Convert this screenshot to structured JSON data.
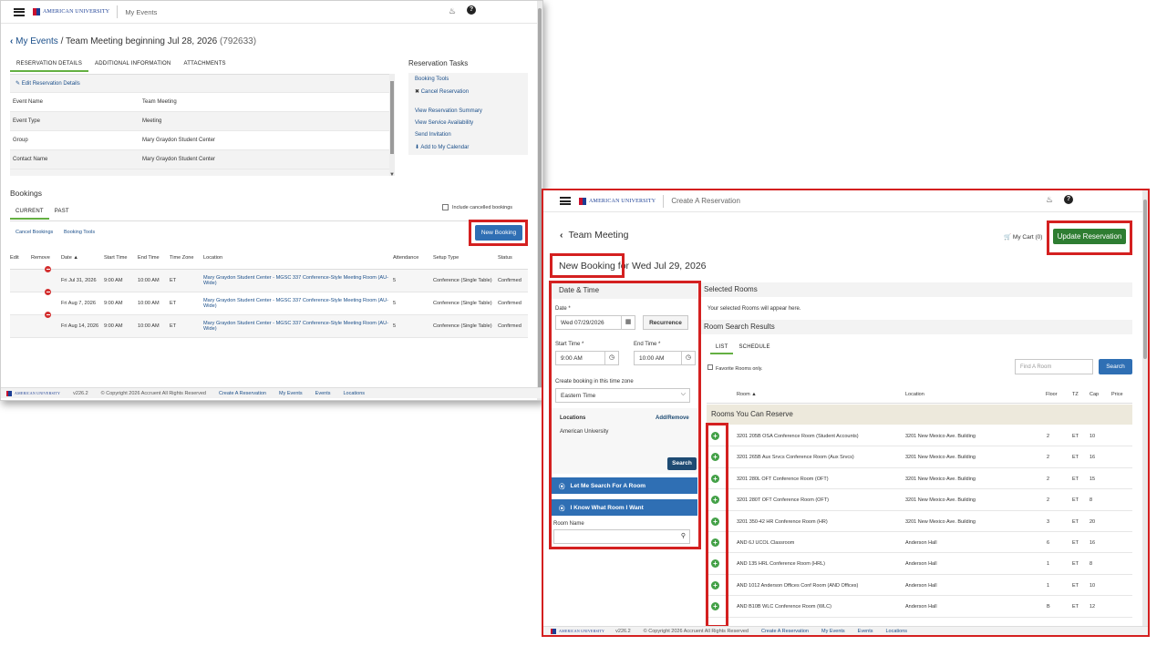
{
  "left": {
    "app_title": "My Events",
    "logo_text": "AMERICAN UNIVERSITY",
    "breadcrumb_root": "My Events",
    "breadcrumb_title": "Team Meeting beginning Jul 28, 2026",
    "breadcrumb_id": "(792633)",
    "tabs": [
      "RESERVATION DETAILS",
      "ADDITIONAL INFORMATION",
      "ATTACHMENTS"
    ],
    "edit_link": "Edit Reservation Details",
    "details": [
      {
        "label": "Event Name",
        "value": "Team Meeting"
      },
      {
        "label": "Event Type",
        "value": "Meeting"
      },
      {
        "label": "Group",
        "value": "Mary Graydon Student Center"
      },
      {
        "label": "Contact Name",
        "value": "Mary Graydon Student Center"
      }
    ],
    "tasks_title": "Reservation Tasks",
    "tasks": [
      "Booking Tools",
      "Cancel Reservation",
      "View Reservation Summary",
      "View Service Availability",
      "Send Invitation",
      "Add to My Calendar"
    ],
    "bookings_title": "Bookings",
    "booking_tabs": [
      "CURRENT",
      "PAST"
    ],
    "include_cancelled": "Include cancelled bookings",
    "cancel_bookings": "Cancel Bookings",
    "booking_tools": "Booking Tools",
    "new_booking": "New Booking",
    "columns": [
      "Edit",
      "Remove",
      "Date",
      "Start Time",
      "End Time",
      "Time Zone",
      "Location",
      "Attendance",
      "Setup Type",
      "Status"
    ],
    "rows": [
      {
        "date": "Fri Jul 31, 2026",
        "start": "9:00 AM",
        "end": "10:00 AM",
        "tz": "ET",
        "location": "Mary Graydon Student Center - MGSC 337 Conference-Style Meeting Room (AU-Wide)",
        "attendance": "5",
        "setup": "Conference (Single Table)",
        "status": "Confirmed"
      },
      {
        "date": "Fri Aug 7, 2026",
        "start": "9:00 AM",
        "end": "10:00 AM",
        "tz": "ET",
        "location": "Mary Graydon Student Center - MGSC 337 Conference-Style Meeting Room (AU-Wide)",
        "attendance": "5",
        "setup": "Conference (Single Table)",
        "status": "Confirmed"
      },
      {
        "date": "Fri Aug 14, 2026",
        "start": "9:00 AM",
        "end": "10:00 AM",
        "tz": "ET",
        "location": "Mary Graydon Student Center - MGSC 337 Conference-Style Meeting Room (AU-Wide)",
        "attendance": "5",
        "setup": "Conference (Single Table)",
        "status": "Confirmed"
      }
    ],
    "footer": {
      "version": "v226.2",
      "copyright": "© Copyright 2026 Accruent All Rights Reserved",
      "links": [
        "Create A Reservation",
        "My Events",
        "Events",
        "Locations"
      ]
    }
  },
  "right": {
    "app_title": "Create A Reservation",
    "logo_text": "AMERICAN UNIVERSITY",
    "back_title": "Team Meeting",
    "cart": "My Cart (0)",
    "update_btn": "Update Reservation",
    "heading_a": "New Booking",
    "heading_b": "for Wed Jul 29, 2026",
    "date_time": "Date & Time",
    "date_label": "Date *",
    "date_value": "Wed 07/29/2026",
    "recurrence": "Recurrence",
    "start_label": "Start Time *",
    "start_value": "9:00 AM",
    "end_label": "End Time *",
    "end_value": "10:00 AM",
    "tz_label": "Create booking in this time zone",
    "tz_value": "Eastern Time",
    "locations_label": "Locations",
    "add_remove": "Add/Remove",
    "location_value": "American University",
    "search_btn": "Search",
    "let_me_search": "Let Me Search For A Room",
    "i_know": "I Know What Room I Want",
    "room_name_label": "Room Name",
    "selected_rooms": "Selected Rooms",
    "selected_hint": "Your selected Rooms will appear here.",
    "room_search_results": "Room Search Results",
    "result_tabs": [
      "LIST",
      "SCHEDULE"
    ],
    "favorite": "Favorite Rooms only.",
    "find_placeholder": "Find A Room",
    "search2": "Search",
    "columns": [
      "Room",
      "Location",
      "Floor",
      "TZ",
      "Cap",
      "Price"
    ],
    "group_header": "Rooms You Can Reserve",
    "rooms": [
      {
        "room": "3201 205B OSA Conference Room (Student Accounts)",
        "location": "3201 New Mexico Ave. Building",
        "floor": "2",
        "tz": "ET",
        "cap": "10"
      },
      {
        "room": "3201 265B Aux Srvcs Conference Room (Aux Srvcs)",
        "location": "3201 New Mexico Ave. Building",
        "floor": "2",
        "tz": "ET",
        "cap": "16"
      },
      {
        "room": "3201 280L OFT Conference Room (OFT)",
        "location": "3201 New Mexico Ave. Building",
        "floor": "2",
        "tz": "ET",
        "cap": "15"
      },
      {
        "room": "3201 280T OFT Conference Room (OFT)",
        "location": "3201 New Mexico Ave. Building",
        "floor": "2",
        "tz": "ET",
        "cap": "8"
      },
      {
        "room": "3201 350-42 HR Conference Room (HR)",
        "location": "3201 New Mexico Ave. Building",
        "floor": "3",
        "tz": "ET",
        "cap": "20"
      },
      {
        "room": "AND 6J UCOL Classroom",
        "location": "Anderson Hall",
        "floor": "6",
        "tz": "ET",
        "cap": "16"
      },
      {
        "room": "AND 135 HRL Conference Room (HRL)",
        "location": "Anderson Hall",
        "floor": "1",
        "tz": "ET",
        "cap": "8"
      },
      {
        "room": "AND 1012 Anderson Offices Conf Room (AND Offices)",
        "location": "Anderson Hall",
        "floor": "1",
        "tz": "ET",
        "cap": "10"
      },
      {
        "room": "AND B10B WLC Conference Room (WLC)",
        "location": "Anderson Hall",
        "floor": "B",
        "tz": "ET",
        "cap": "12"
      }
    ],
    "footer": {
      "version": "v226.2",
      "copyright": "© Copyright 2026 Accruent All Rights Reserved",
      "links": [
        "Create A Reservation",
        "My Events",
        "Events",
        "Locations"
      ]
    }
  }
}
